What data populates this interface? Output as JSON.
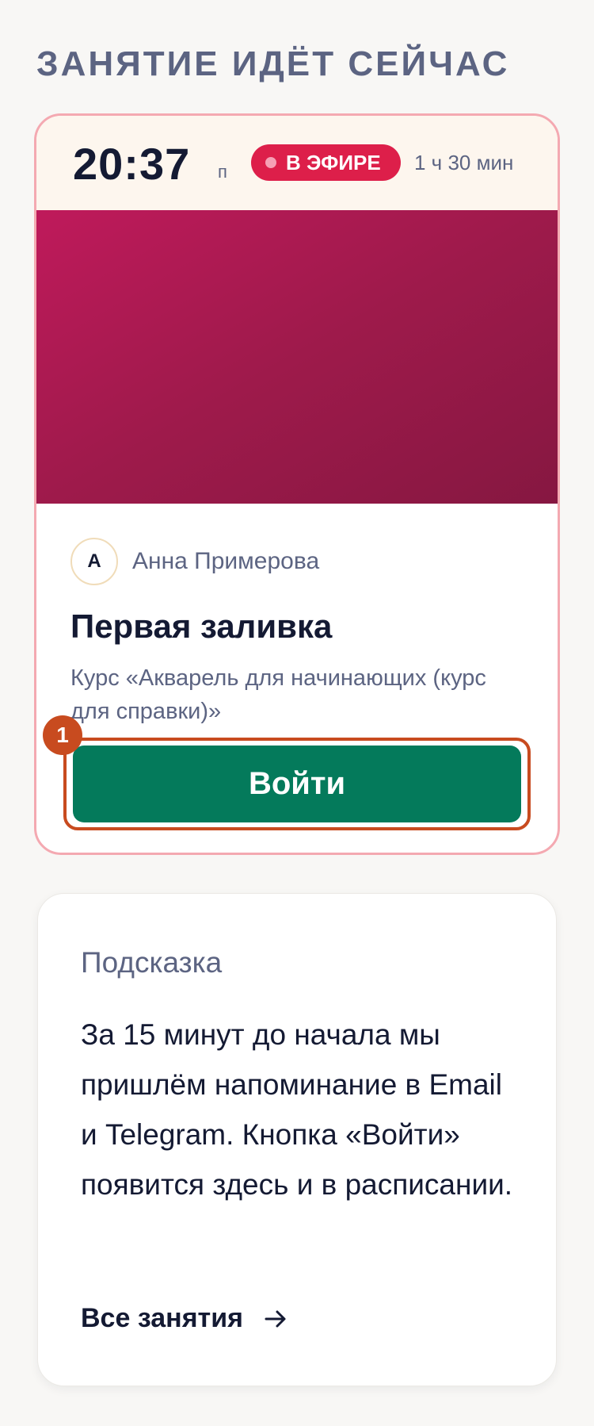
{
  "section": {
    "title": "ЗАНЯТИЕ ИДЁТ СЕЙЧАС"
  },
  "live_card": {
    "time": "20:37",
    "day": "п",
    "badge": "В ЭФИРЕ",
    "duration": "1 ч 30 мин",
    "teacher": {
      "initial": "А",
      "name": "Анна Примерова"
    },
    "lesson_title": "Первая заливка",
    "course": "Курс «Акварель для начинающих (курс для справки)»",
    "join_label": "Войти",
    "marker": "1"
  },
  "hint_card": {
    "title": "Подсказка",
    "text": "За 15 минут до начала мы пришлём напоминание в Email и Telegram. Кнопка «Войти» появится здесь и в расписании.",
    "link_label": "Все занятия",
    "link_icon": "arrow-right-icon"
  },
  "colors": {
    "live_badge": "#dd1f4a",
    "join_button": "#047a5b",
    "marker": "#c84b1f",
    "card_border": "#f4a9b1"
  }
}
